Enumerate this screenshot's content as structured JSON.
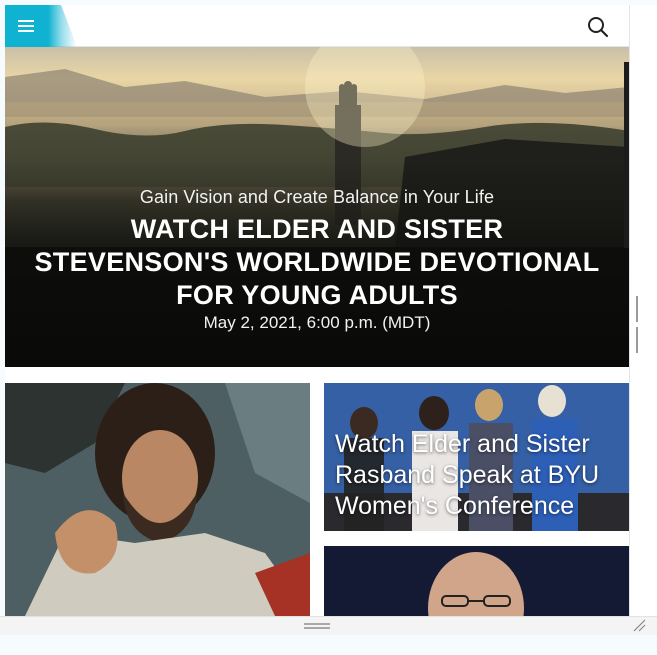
{
  "header": {
    "menu_icon": "hamburger-menu-icon",
    "search_icon": "search-icon",
    "accent_color": "#10b2d1"
  },
  "hero": {
    "subtitle": "Gain Vision and Create Balance in Your Life",
    "title": "WATCH ELDER AND SISTER STEVENSON'S WORLDWIDE DEVOTIONAL FOR YOUNG ADULTS",
    "date": "May 2, 2021, 6:00 p.m. (MDT)"
  },
  "tiles": [
    {
      "caption": ""
    },
    {
      "caption": "Watch Elder and Sister Rasband Speak at BYU Women's Conference"
    },
    {
      "caption": ""
    }
  ]
}
